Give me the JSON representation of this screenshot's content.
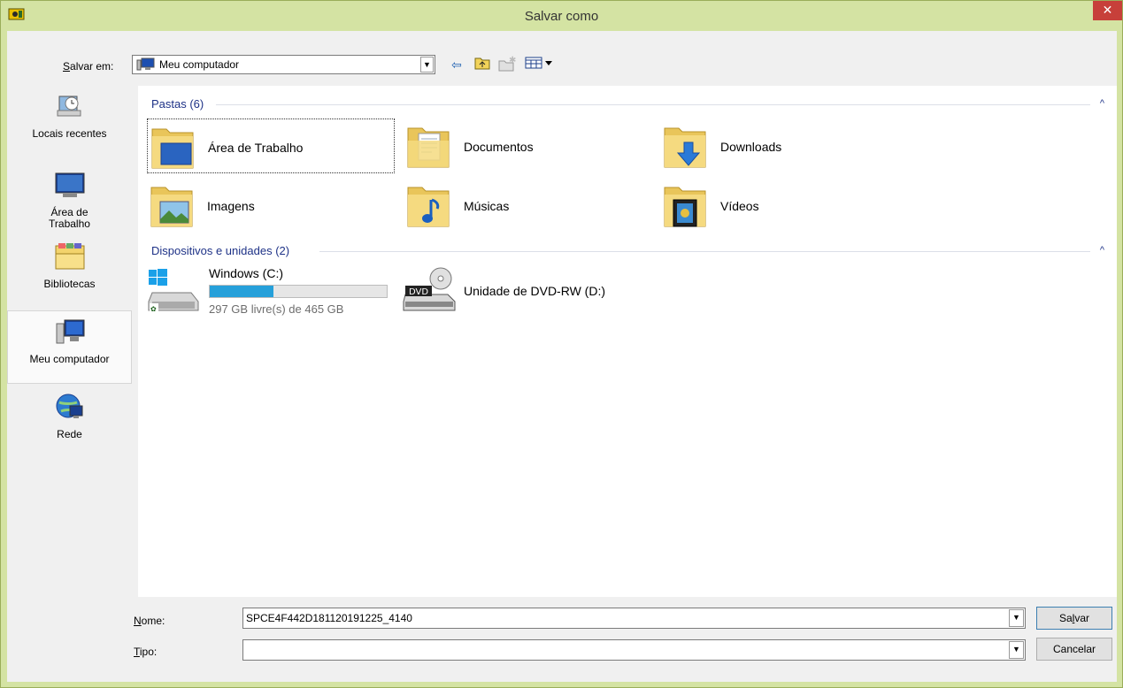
{
  "window": {
    "title": "Salvar como",
    "close_symbol": "✕",
    "app_icon": "app-icon"
  },
  "lookin": {
    "label_prefix": "S",
    "label_rest": "alvar em:",
    "value": "Meu computador"
  },
  "toolbar": {
    "back_icon": "⇦",
    "up_icon": "⇪",
    "newfolder_icon": "✱",
    "view_icon": "▦▾"
  },
  "places": [
    {
      "label": "Locais recentes",
      "icon": "recent-places-icon"
    },
    {
      "label": "Área de Trabalho",
      "icon": "desktop-icon"
    },
    {
      "label": "Bibliotecas",
      "icon": "libraries-icon"
    },
    {
      "label": "Meu computador",
      "icon": "computer-icon",
      "selected": true
    },
    {
      "label": "Rede",
      "icon": "network-icon"
    }
  ],
  "groups": {
    "folders_header": "Pastas (6)",
    "devices_header": "Dispositivos e unidades (2)",
    "collapse_symbol": "^"
  },
  "folders": [
    {
      "label": "Área de Trabalho",
      "icon": "desktop-folder-icon"
    },
    {
      "label": "Documentos",
      "icon": "documents-folder-icon"
    },
    {
      "label": "Downloads",
      "icon": "downloads-folder-icon"
    },
    {
      "label": "Imagens",
      "icon": "pictures-folder-icon"
    },
    {
      "label": "Músicas",
      "icon": "music-folder-icon"
    },
    {
      "label": "Vídeos",
      "icon": "videos-folder-icon"
    }
  ],
  "drives": [
    {
      "name": "Windows (C:)",
      "free_text": "297 GB livre(s) de 465 GB",
      "used_fraction": 0.36,
      "icon": "windows-drive-icon"
    },
    {
      "name": "Unidade de DVD-RW (D:)",
      "icon": "dvd-drive-icon",
      "badge": "DVD"
    }
  ],
  "filename": {
    "label_prefix": "N",
    "label_rest": "ome:",
    "value": "SPCE4F442D181120191225_4140"
  },
  "filetype": {
    "label_prefix": "T",
    "label_rest": "ipo:",
    "value": ""
  },
  "buttons": {
    "save_prefix": "Sa",
    "save_u": "l",
    "save_rest": "var",
    "cancel": "Cancelar"
  },
  "colors": {
    "titlebar": "#d4e3a3",
    "close": "#c7403a",
    "group_header": "#1e3287",
    "progress": "#26a0da"
  }
}
